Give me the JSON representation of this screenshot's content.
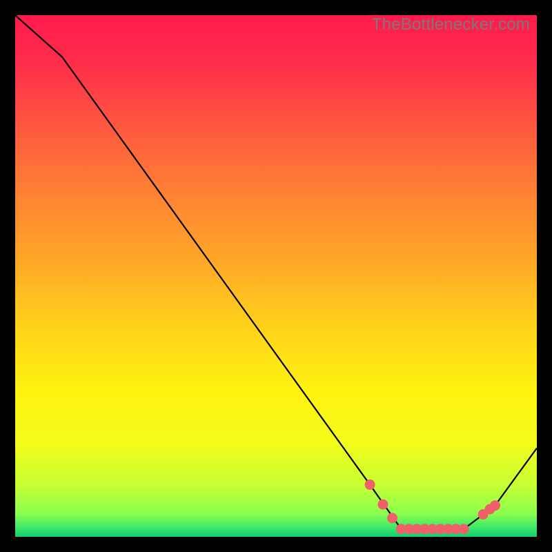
{
  "watermark": "TheBottlenecker.com",
  "chart_data": {
    "type": "line",
    "title": "",
    "xlabel": "",
    "ylabel": "",
    "xlim": [
      0,
      100
    ],
    "ylim": [
      0,
      100
    ],
    "x": [
      0,
      9,
      68,
      74,
      86,
      92,
      100
    ],
    "values": [
      100,
      92,
      10,
      1.5,
      1.5,
      6,
      17
    ],
    "marker_points": [
      {
        "x": 68,
        "y": 10
      },
      {
        "x": 70.5,
        "y": 6.2
      },
      {
        "x": 72.3,
        "y": 3.6
      },
      {
        "x": 74,
        "y": 1.5
      },
      {
        "x": 75.5,
        "y": 1.5
      },
      {
        "x": 77,
        "y": 1.5
      },
      {
        "x": 78.5,
        "y": 1.5
      },
      {
        "x": 80,
        "y": 1.5
      },
      {
        "x": 81.5,
        "y": 1.5
      },
      {
        "x": 83,
        "y": 1.5
      },
      {
        "x": 84.5,
        "y": 1.5
      },
      {
        "x": 86,
        "y": 1.5
      },
      {
        "x": 89.7,
        "y": 4.3
      },
      {
        "x": 91,
        "y": 5.3
      },
      {
        "x": 92,
        "y": 6
      }
    ],
    "gradient_stops": [
      {
        "offset": 0.0,
        "color": "#ff1a4d"
      },
      {
        "offset": 0.1,
        "color": "#ff2f4a"
      },
      {
        "offset": 0.22,
        "color": "#ff5a3f"
      },
      {
        "offset": 0.35,
        "color": "#ff8433"
      },
      {
        "offset": 0.48,
        "color": "#ffaa26"
      },
      {
        "offset": 0.6,
        "color": "#ffd31a"
      },
      {
        "offset": 0.72,
        "color": "#fff20f"
      },
      {
        "offset": 0.82,
        "color": "#f3fc1a"
      },
      {
        "offset": 0.9,
        "color": "#c7ff33"
      },
      {
        "offset": 0.955,
        "color": "#8bff4d"
      },
      {
        "offset": 0.985,
        "color": "#35e56a"
      },
      {
        "offset": 1.0,
        "color": "#0fcf6e"
      }
    ],
    "marker_color": "#ef6068",
    "line_color": "#000000"
  }
}
